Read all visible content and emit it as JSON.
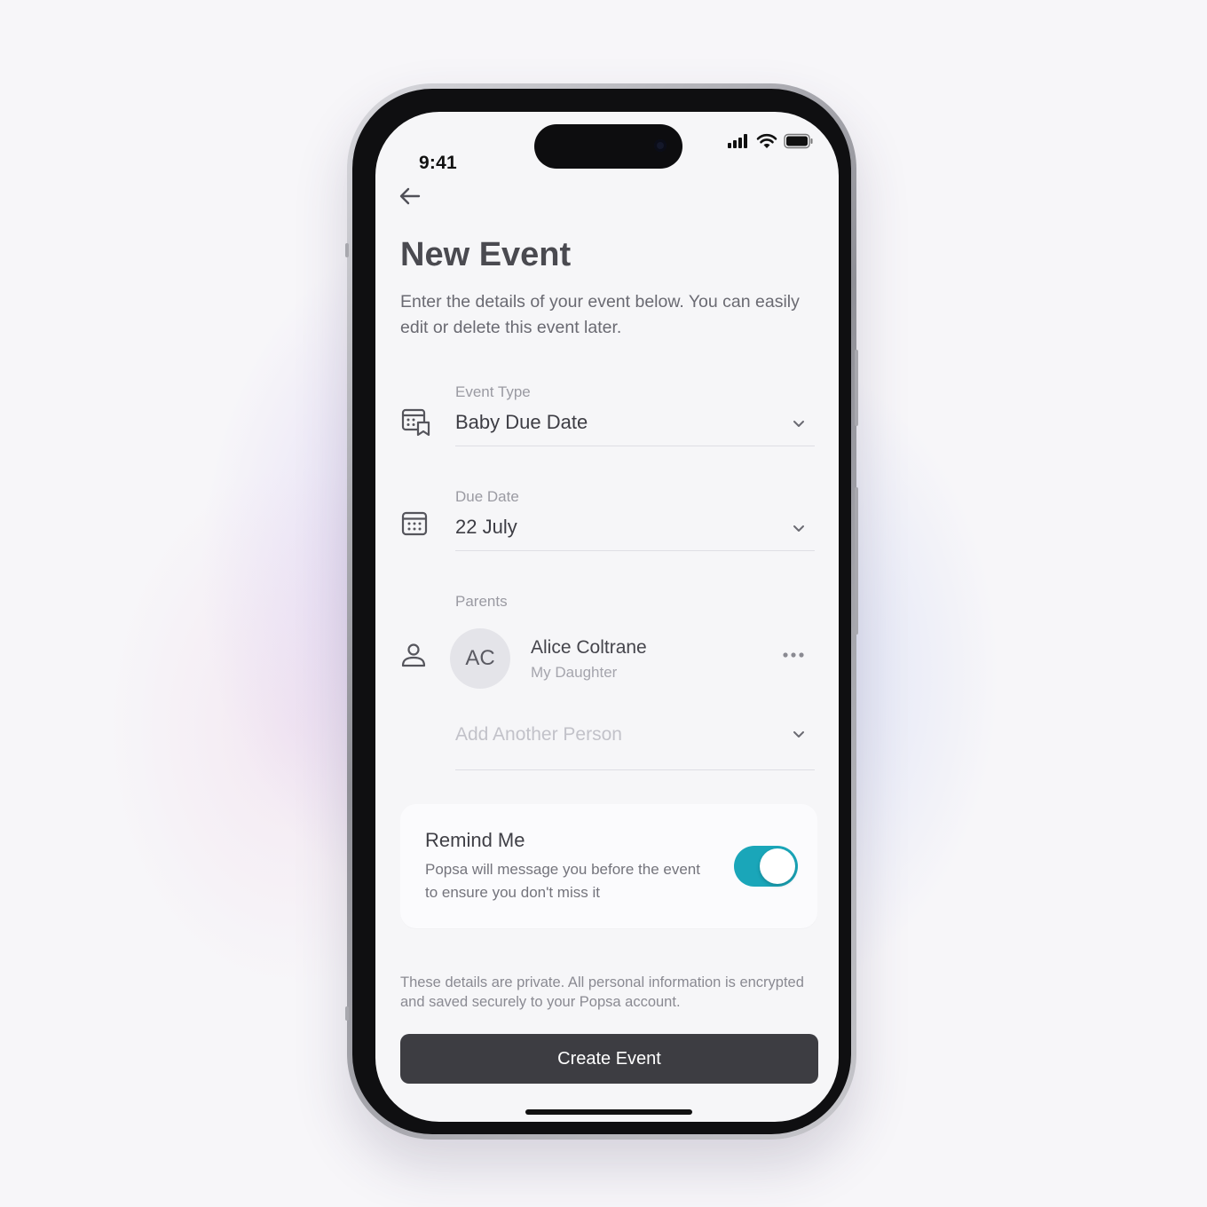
{
  "status_bar": {
    "time": "9:41"
  },
  "page": {
    "title": "New Event",
    "subtitle": "Enter the details of your event below. You can easily edit or delete this event later."
  },
  "fields": {
    "event_type": {
      "label": "Event Type",
      "value": "Baby Due Date"
    },
    "due_date": {
      "label": "Due Date",
      "value": "22 July"
    },
    "parents": {
      "label": "Parents",
      "people": [
        {
          "initials": "AC",
          "name": "Alice Coltrane",
          "relation": "My Daughter"
        }
      ],
      "add_placeholder": "Add Another Person"
    }
  },
  "remind": {
    "title": "Remind Me",
    "description": "Popsa will message you before the event to ensure you don't miss it",
    "enabled": true
  },
  "privacy_note": "These details are private. All personal information is encrypted and saved securely to your Popsa account.",
  "cta": {
    "label": "Create Event"
  },
  "colors": {
    "accent": "#1aa6b9",
    "button_bg": "#3d3d42",
    "screen_bg": "#f6f6f8"
  },
  "icons": [
    "back-arrow-icon",
    "calendar-event-icon",
    "calendar-icon",
    "person-icon",
    "more-icon",
    "chevron-down-icon",
    "signal-icon",
    "wifi-icon",
    "battery-icon"
  ]
}
